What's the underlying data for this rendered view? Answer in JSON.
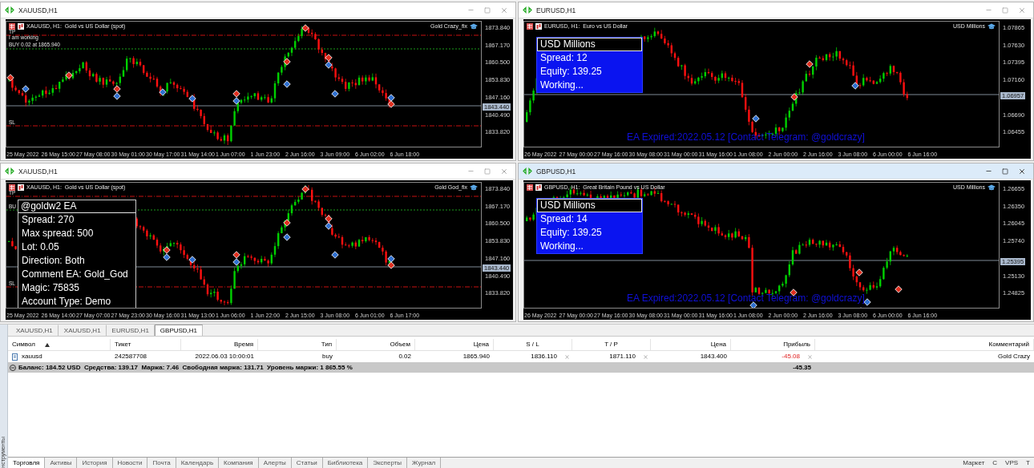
{
  "charts": [
    {
      "title": "XAUUSD,H1",
      "active": false,
      "header": "XAUUSD, H1:  Gold vs US Dollar (spot)",
      "expert": "Gold Crazy_fix",
      "prices": [
        "1873.840",
        "1867.170",
        "1860.500",
        "1853.830",
        "1847.160",
        "1840.490",
        "1833.820"
      ],
      "current_price": "1843.440",
      "times": [
        "25 May 2022",
        "26 May 15:00",
        "27 May 08:00",
        "30 May 01:00",
        "30 May 17:00",
        "31 May 14:00",
        "1 Jun 07:00",
        "1 Jun 23:00",
        "2 Jun 16:00",
        "3 Jun 09:00",
        "6 Jun 02:00",
        "6 Jun 18:00"
      ],
      "notes": [
        "TP",
        "I am working",
        "BUY 0.02 at 1865.940",
        "SL"
      ]
    },
    {
      "title": "EURUSD,H1",
      "active": false,
      "header": "EURUSD, H1:  Euro vs US Dollar",
      "expert": "USD Millions",
      "prices": [
        "1.07865",
        "1.07630",
        "1.07395",
        "1.07160",
        "1.06690",
        "1.06455"
      ],
      "current_price": "1.06957",
      "times": [
        "26 May 2022",
        "27 May 00:00",
        "27 May 16:00",
        "30 May 08:00",
        "31 May 00:00",
        "31 May 16:00",
        "1 Jun 08:00",
        "2 Jun 00:00",
        "2 Jun 16:00",
        "3 Jun 08:00",
        "6 Jun 00:00",
        "6 Jun 16:00"
      ],
      "panel": {
        "kind": "blue",
        "title": "USD Millions",
        "lines": [
          "Spread: 12",
          "Equity: 139.25",
          "Working..."
        ]
      },
      "notice": "EA Expired:2022.05.12 [Contact Telegram: @goldcrazy]"
    },
    {
      "title": "XAUUSD,H1",
      "active": false,
      "header": "XAUUSD, H1:  Gold vs US Dollar (spot)",
      "expert": "Gold God_fix",
      "prices": [
        "1873.840",
        "1867.170",
        "1860.500",
        "1853.830",
        "1847.160",
        "1840.490",
        "1833.820"
      ],
      "current_price": "1843.440",
      "times": [
        "25 May 2022",
        "26 May 14:00",
        "27 May 07:00",
        "27 May 23:00",
        "30 May 16:00",
        "31 May 13:00",
        "1 Jun 06:00",
        "1 Jun 22:00",
        "2 Jun 15:00",
        "3 Jun 08:00",
        "6 Jun 01:00",
        "6 Jun 17:00"
      ],
      "notes": [
        "TP",
        "BU",
        "SL"
      ],
      "panel": {
        "kind": "dark",
        "title": "@goldw2 EA",
        "lines": [
          "Spread: 270",
          "Max spread: 500",
          "Lot: 0.05",
          "Direction: Both",
          "Comment EA: Gold_God",
          "Magic: 75835",
          "Account Type: Demo"
        ]
      }
    },
    {
      "title": "GBPUSD,H1",
      "active": true,
      "header": "GBPUSD, H1:  Great Britain Pound vs US Dollar",
      "expert": "USD Millions",
      "prices": [
        "1.26655",
        "1.26350",
        "1.26045",
        "1.25740",
        "1.25130",
        "1.24825"
      ],
      "current_price": "1.25395",
      "times": [
        "26 May 2022",
        "27 May 00:00",
        "27 May 16:00",
        "30 May 08:00",
        "31 May 00:00",
        "31 May 16:00",
        "1 Jun 08:00",
        "2 Jun 00:00",
        "2 Jun 16:00",
        "3 Jun 08:00",
        "6 Jun 00:00",
        "6 Jun 16:00"
      ],
      "panel": {
        "kind": "blue",
        "title": "USD Millions",
        "lines": [
          "Spread: 14",
          "Equity: 139.25",
          "Working..."
        ]
      },
      "notice": "EA Expired:2022.05.12 [Contact Telegram: @goldcrazy]"
    }
  ],
  "chart_tabs": [
    {
      "label": "XAUUSD,H1",
      "selected": false
    },
    {
      "label": "XAUUSD,H1",
      "selected": false
    },
    {
      "label": "EURUSD,H1",
      "selected": false
    },
    {
      "label": "GBPUSD,H1",
      "selected": true
    }
  ],
  "table": {
    "columns": [
      "Символ",
      "Тикет",
      "Время",
      "Тип",
      "Объем",
      "Цена",
      "S / L",
      "T / P",
      "Цена",
      "Прибыль",
      "Комментарий"
    ],
    "rows": [
      {
        "symbol": "xauusd",
        "ticket": "242587708",
        "time": "2022.06.03 10:00:01",
        "type": "buy",
        "volume": "0.02",
        "price": "1865.940",
        "sl": "1836.110",
        "tp": "1871.110",
        "price_current": "1843.400",
        "profit": "-45.08",
        "comment": "Gold Crazy"
      }
    ],
    "summary": {
      "text": "Баланс: 184.52 USD  Средства: 139.17  Маржа: 7.46  Свободная маржа: 131.71  Уровень маржи: 1 865.55 %",
      "total": "-45.35"
    }
  },
  "side_label": "нструменты",
  "bottom_tabs": [
    {
      "label": "Торговля",
      "selected": true
    },
    {
      "label": "Активы",
      "selected": false
    },
    {
      "label": "История",
      "selected": false
    },
    {
      "label": "Новости",
      "selected": false
    },
    {
      "label": "Почта",
      "selected": false
    },
    {
      "label": "Календарь",
      "selected": false
    },
    {
      "label": "Компания",
      "selected": false
    },
    {
      "label": "Алерты",
      "selected": false
    },
    {
      "label": "Статьи",
      "selected": false
    },
    {
      "label": "Библиотека",
      "selected": false
    },
    {
      "label": "Эксперты",
      "selected": false
    },
    {
      "label": "Журнал",
      "selected": false
    }
  ],
  "bottom_right": [
    "Маркет",
    "С",
    "VPS",
    "Т"
  ]
}
